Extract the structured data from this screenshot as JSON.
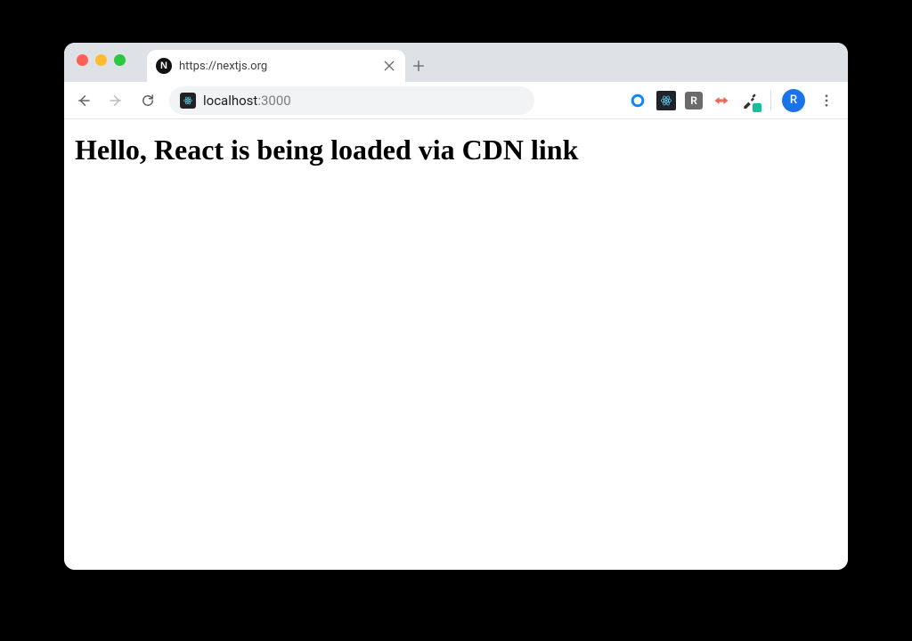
{
  "window": {
    "traffic_lights": [
      "close",
      "minimize",
      "zoom"
    ]
  },
  "tabs": {
    "active": {
      "favicon_letter": "N",
      "title": "https://nextjs.org"
    }
  },
  "addressbar": {
    "host": "localhost",
    "port": ":3000"
  },
  "extensions": {
    "ring": "loader-ring",
    "react": "react-devtools",
    "r_badge": "R",
    "redarrow": "redux-devtools",
    "picker": "color-picker"
  },
  "profile": {
    "initial": "R"
  },
  "page": {
    "heading": "Hello, React is being loaded via CDN link"
  }
}
